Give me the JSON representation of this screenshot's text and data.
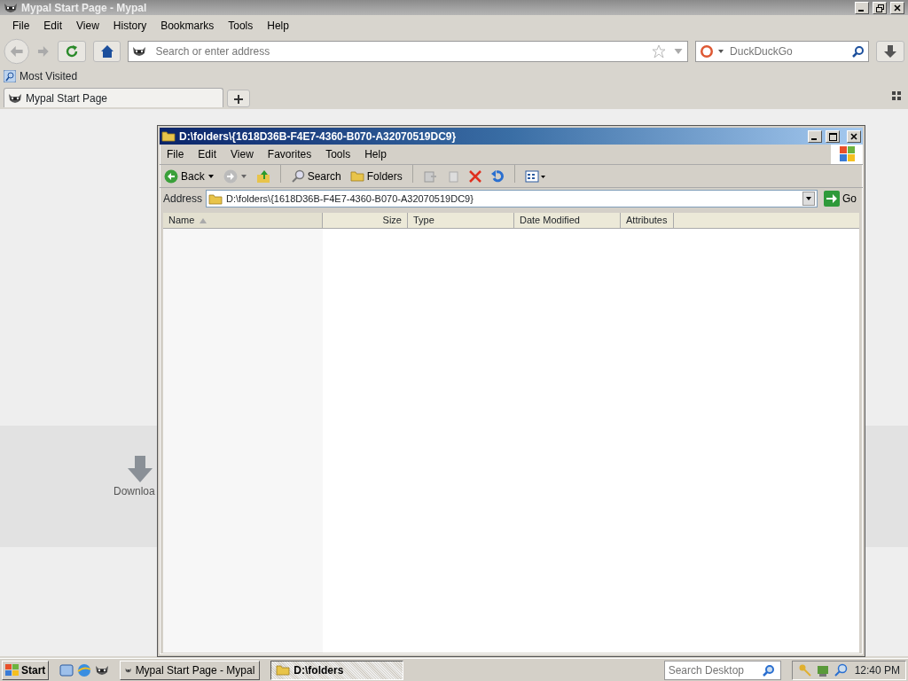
{
  "browser": {
    "title": "Mypal Start Page - Mypal",
    "menu": [
      "File",
      "Edit",
      "View",
      "History",
      "Bookmarks",
      "Tools",
      "Help"
    ],
    "address_placeholder": "Search or enter address",
    "search_placeholder": "DuckDuckGo",
    "bookmarks": [
      "Most Visited"
    ],
    "tabs": [
      {
        "label": "Mypal Start Page",
        "selected": true
      }
    ],
    "launcher_label": "Downloa"
  },
  "explorer": {
    "title": "D:\\folders\\{1618D36B-F4E7-4360-B070-A32070519DC9}",
    "menu": [
      "File",
      "Edit",
      "View",
      "Favorites",
      "Tools",
      "Help"
    ],
    "toolbar": [
      {
        "kind": "back",
        "label": "Back"
      },
      {
        "kind": "forward"
      },
      {
        "kind": "up"
      },
      {
        "kind": "search",
        "label": "Search"
      },
      {
        "kind": "folders",
        "label": "Folders"
      },
      {
        "kind": "move"
      },
      {
        "kind": "copy"
      },
      {
        "kind": "delete"
      },
      {
        "kind": "undo"
      },
      {
        "kind": "views"
      }
    ],
    "address_label": "Address",
    "address": "D:\\folders\\{1618D36B-F4E7-4360-B070-A32070519DC9}",
    "go_label": "Go",
    "columns": [
      {
        "label": "Name",
        "sorted": true
      },
      {
        "label": "Size",
        "sorted": false
      },
      {
        "label": "Type",
        "sorted": false
      },
      {
        "label": "Date Modified",
        "sorted": false
      },
      {
        "label": "Attributes",
        "sorted": false
      }
    ]
  },
  "taskbar": {
    "start": "Start",
    "tasks": [
      {
        "label": "Mypal Start Page - Mypal",
        "selected": false
      },
      {
        "label": "D:\\folders",
        "selected": true
      }
    ],
    "search_placeholder": "Search Desktop",
    "clock": "12:40 PM"
  }
}
